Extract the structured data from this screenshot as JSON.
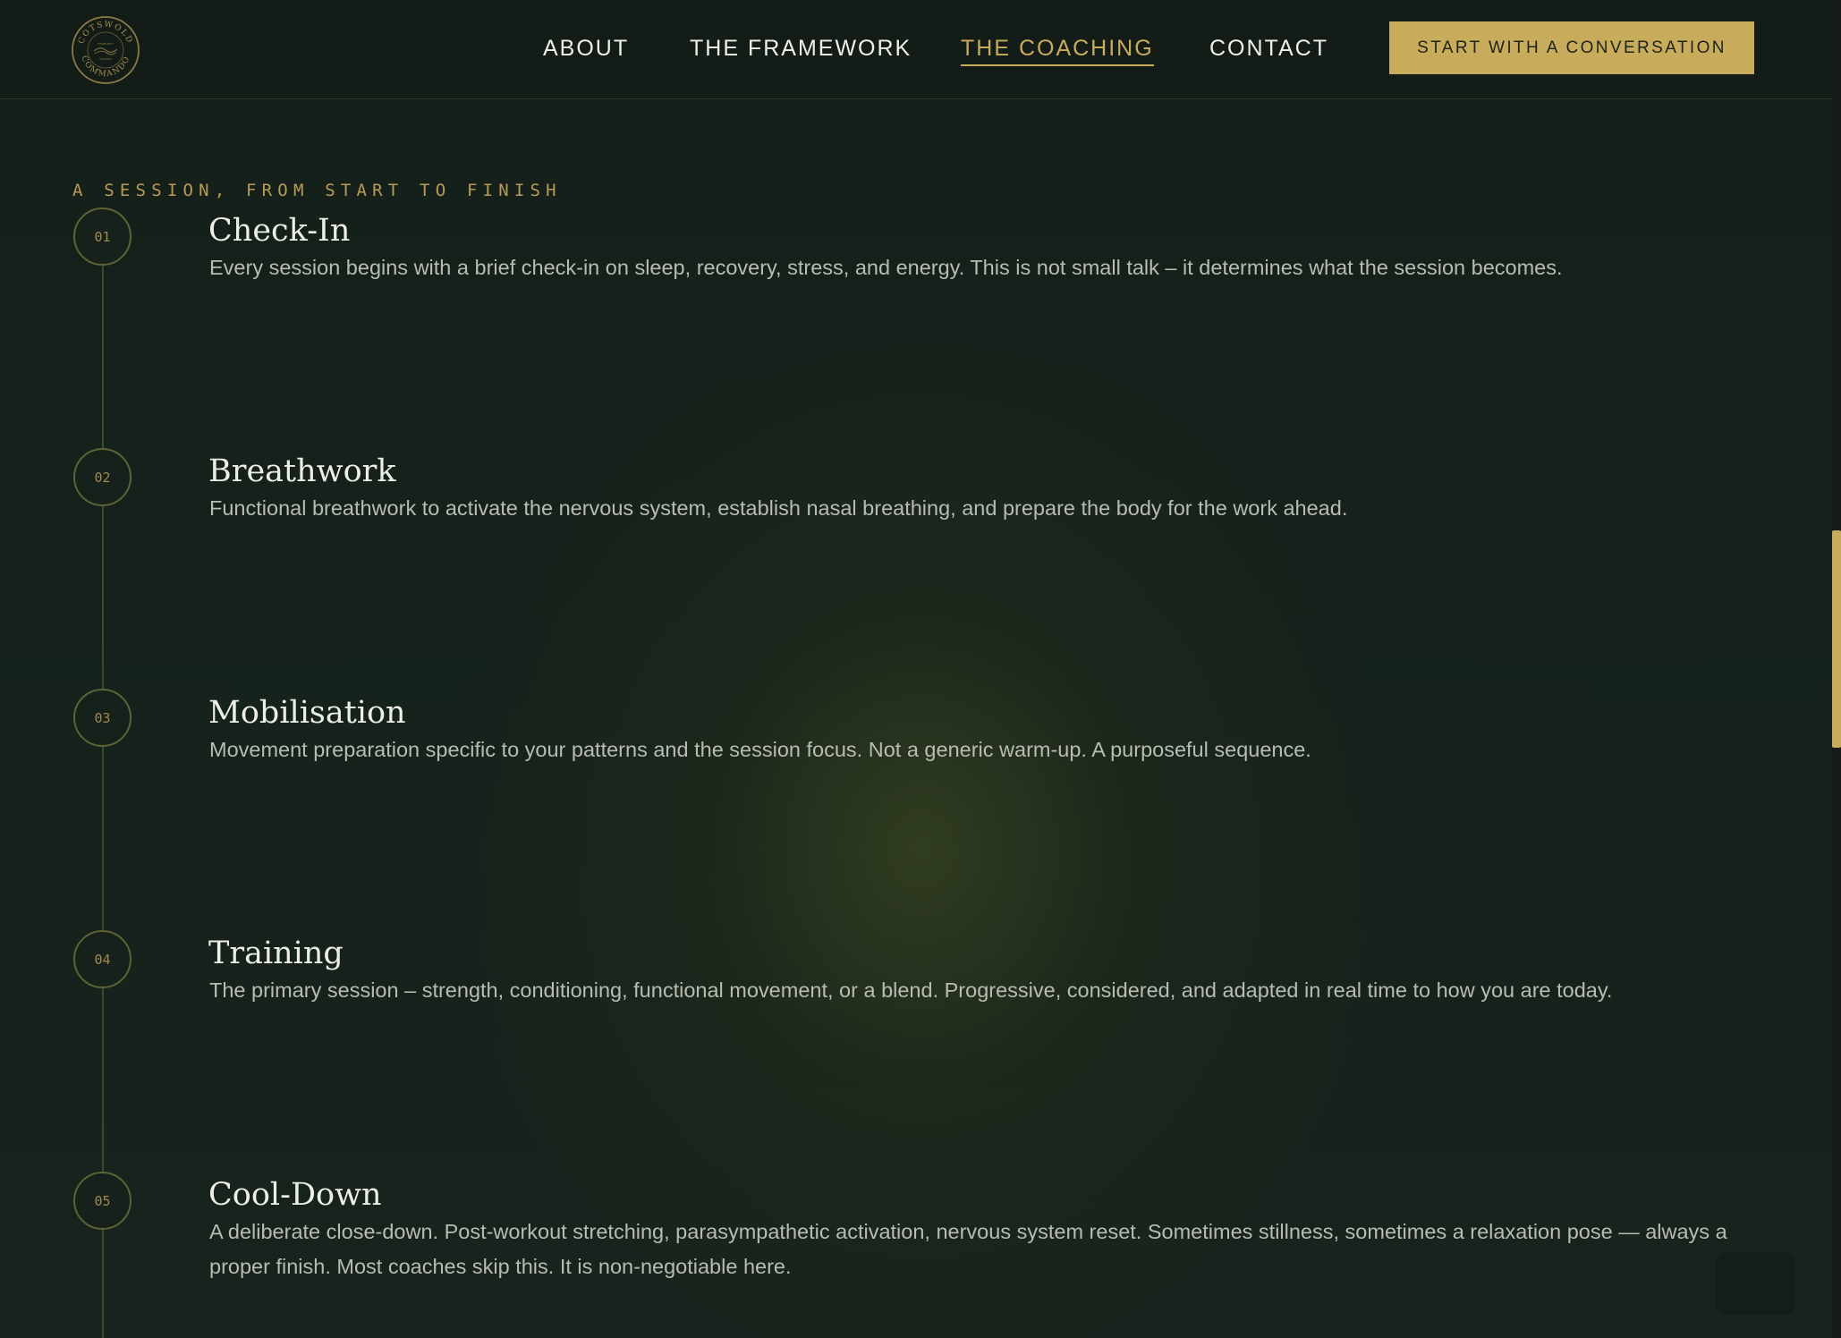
{
  "brand": {
    "logo_top_text": "COTSWOLD",
    "logo_bottom_text": "COMMANDO",
    "logo_inner_top": "COMMUNITY",
    "logo_inner_bottom": "LONDON"
  },
  "nav": {
    "items": [
      {
        "label": "ABOUT",
        "active": false
      },
      {
        "label": "THE FRAMEWORK",
        "active": false
      },
      {
        "label": "THE COACHING",
        "active": true
      },
      {
        "label": "CONTACT",
        "active": false
      }
    ],
    "cta_label": "START WITH A CONVERSATION"
  },
  "session": {
    "eyebrow": "A SESSION, FROM START TO FINISH",
    "steps": [
      {
        "number": "01",
        "title": "Check-In",
        "description": "Every session begins with a brief check-in on sleep, recovery, stress, and energy. This is not small talk – it determines what the session becomes."
      },
      {
        "number": "02",
        "title": "Breathwork",
        "description": "Functional breathwork to activate the nervous system, establish nasal breathing, and prepare the body for the work ahead."
      },
      {
        "number": "03",
        "title": "Mobilisation",
        "description": "Movement preparation specific to your patterns and the session focus. Not a generic warm-up. A purposeful sequence."
      },
      {
        "number": "04",
        "title": "Training",
        "description": "The primary session – strength, conditioning, functional movement, or a blend. Progressive, considered, and adapted in real time to how you are today."
      },
      {
        "number": "05",
        "title": "Cool-Down",
        "description": "A deliberate close-down. Post-workout stretching, parasympathetic activation, nervous system reset. Sometimes stillness, sometimes a relaxation pose — always a proper finish. Most coaches skip this. It is non-negotiable here."
      }
    ]
  },
  "colors": {
    "background": "#16201a",
    "accent_gold": "#c9ab5c",
    "text_light": "#eceee7",
    "text_muted": "#b8bcb2"
  }
}
